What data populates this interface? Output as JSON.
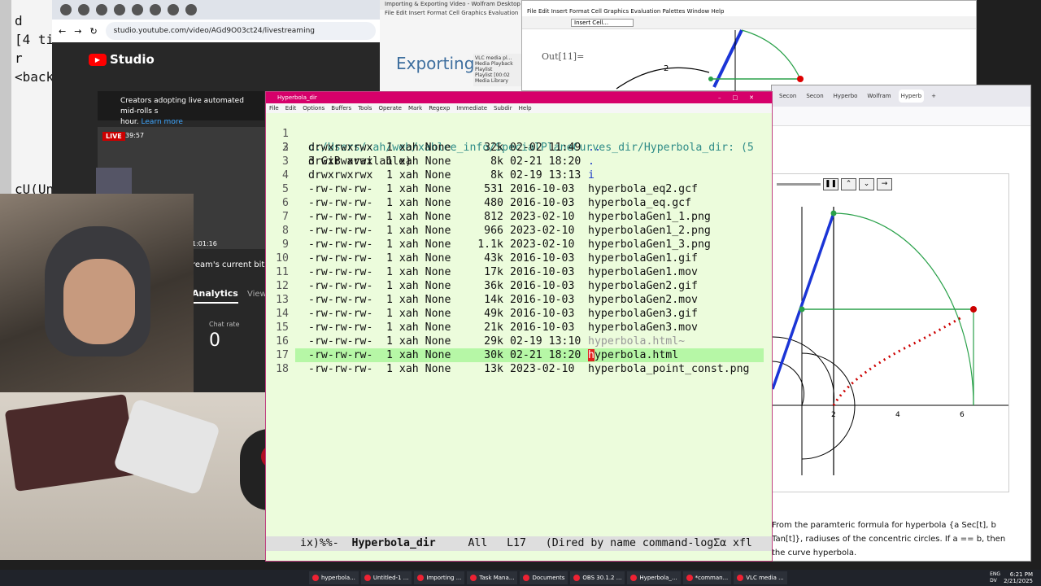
{
  "terminal": {
    "lines": [
      "d",
      "[4 ti",
      "r",
      "<back",
      "",
      "",
      "",
      "",
      "",
      "cU(Uni"
    ]
  },
  "youtube": {
    "url": "studio.youtube.com/video/AGd9O03ct24/livestreaming",
    "logo_text": "Studio",
    "banner_text": "Creators adopting live automated mid-rolls s",
    "banner_text2": "hour.",
    "learn_more": "Learn more",
    "live_badge": "LIVE",
    "live_time": "39:57",
    "duration": "1:01:16",
    "sidebar_text": "ream's current bitra",
    "tab_analytics": "Analytics",
    "tab_views": "View",
    "chat_rate_label": "Chat rate",
    "chat_rate_value": "0"
  },
  "wolfram_small": {
    "title": "Importing & Exporting Video - Wolfram Desktop",
    "menu": "File  Edit  Insert  Format  Cell  Graphics  Evaluation",
    "heading": "Exporting"
  },
  "vlc": {
    "title": "VLC media pl...",
    "items": [
      "Media  Playback",
      "Playlist",
      "Playlist [00:02",
      "Media Library"
    ]
  },
  "notebook": {
    "menu": "File  Edit  Insert  Format  Cell  Graphics  Evaluation  Palettes  Window  Help",
    "insert_cell": "Insert Cell...",
    "out_label": "Out[11]=",
    "axis_label_2": "2"
  },
  "right_browser": {
    "tabs": [
      "Secon",
      "Secon",
      "Hyperbo",
      "Wolfram",
      "Hyperb"
    ],
    "axis_ticks": [
      "2",
      "4",
      "6"
    ],
    "description": "From the paramteric formula for hyperbola {a Sec[t], b Tan[t]}, radiuses of the concentric circles. If a == b, then the curve hyperbola."
  },
  "emacs": {
    "title": "Hyperbola_dir",
    "menu": [
      "File",
      "Edit",
      "Options",
      "Buffers",
      "Tools",
      "Operate",
      "Mark",
      "Regexp",
      "Immediate",
      "Subdir",
      "Help"
    ],
    "header_path": "c:/Users/xah/web/xahlee_info/SpecialPlaneCurves_dir/Hyperbola_dir: (5 ",
    "header_cont": "3 GiB available)",
    "entries": [
      {
        "ln": "2",
        "perm": "drwxrwxrwx",
        "size": "32k",
        "date": "02-02 11:49",
        "name": ".."
      },
      {
        "ln": "3",
        "perm": "drwxrwxrwx",
        "size": "8k",
        "date": "02-21 18:20",
        "name": "."
      },
      {
        "ln": "4",
        "perm": "drwxrwxrwx",
        "size": "8k",
        "date": "02-19 13:13",
        "name": "i"
      },
      {
        "ln": "5",
        "perm": "-rw-rw-rw-",
        "size": "531",
        "date": "2016-10-03",
        "name": "hyperbola_eq2.gcf"
      },
      {
        "ln": "6",
        "perm": "-rw-rw-rw-",
        "size": "480",
        "date": "2016-10-03",
        "name": "hyperbola_eq.gcf"
      },
      {
        "ln": "7",
        "perm": "-rw-rw-rw-",
        "size": "812",
        "date": "2023-02-10",
        "name": "hyperbolaGen1_1.png"
      },
      {
        "ln": "8",
        "perm": "-rw-rw-rw-",
        "size": "966",
        "date": "2023-02-10",
        "name": "hyperbolaGen1_2.png"
      },
      {
        "ln": "9",
        "perm": "-rw-rw-rw-",
        "size": "1.1k",
        "date": "2023-02-10",
        "name": "hyperbolaGen1_3.png"
      },
      {
        "ln": "10",
        "perm": "-rw-rw-rw-",
        "size": "43k",
        "date": "2016-10-03",
        "name": "hyperbolaGen1.gif"
      },
      {
        "ln": "11",
        "perm": "-rw-rw-rw-",
        "size": "17k",
        "date": "2016-10-03",
        "name": "hyperbolaGen1.mov"
      },
      {
        "ln": "12",
        "perm": "-rw-rw-rw-",
        "size": "36k",
        "date": "2016-10-03",
        "name": "hyperbolaGen2.gif"
      },
      {
        "ln": "13",
        "perm": "-rw-rw-rw-",
        "size": "14k",
        "date": "2016-10-03",
        "name": "hyperbolaGen2.mov"
      },
      {
        "ln": "14",
        "perm": "-rw-rw-rw-",
        "size": "49k",
        "date": "2016-10-03",
        "name": "hyperbolaGen3.gif"
      },
      {
        "ln": "15",
        "perm": "-rw-rw-rw-",
        "size": "21k",
        "date": "2016-10-03",
        "name": "hyperbolaGen3.mov"
      },
      {
        "ln": "16",
        "perm": "-rw-rw-rw-",
        "size": "29k",
        "date": "02-19 13:10",
        "name": "hyperbola.html~"
      },
      {
        "ln": "17",
        "perm": "-rw-rw-rw-",
        "size": "30k",
        "date": "02-21 18:20",
        "name": "hyperbola.html"
      },
      {
        "ln": "18",
        "perm": "-rw-rw-rw-",
        "size": "13k",
        "date": "2023-02-10",
        "name": "hyperbola_point_const.png"
      }
    ],
    "owner": "1 xah None",
    "modeline": {
      "prefix": "ix)%%-",
      "buffer": "Hyperbola_dir",
      "position": "All",
      "line": "L17",
      "mode": "(Dired by name command-logΣα xfl"
    }
  },
  "taskbar": {
    "items": [
      "hyperbola...",
      "Untitled-1 ...",
      "Importing ...",
      "Task Mana...",
      "Documents",
      "OBS 30.1.2 ...",
      "Hyperbola_...",
      "*comman...",
      "VLC media ..."
    ],
    "lang": "ENG",
    "lang2": "DV",
    "time": "6:21 PM",
    "date": "2/21/2025"
  },
  "colors": {
    "emacs_bg": "#ecfcdc",
    "emacs_title": "#d6006a",
    "hl_line": "#b6f7a6",
    "dir_color": "#1a37c8",
    "path_color": "#2e8b87"
  }
}
